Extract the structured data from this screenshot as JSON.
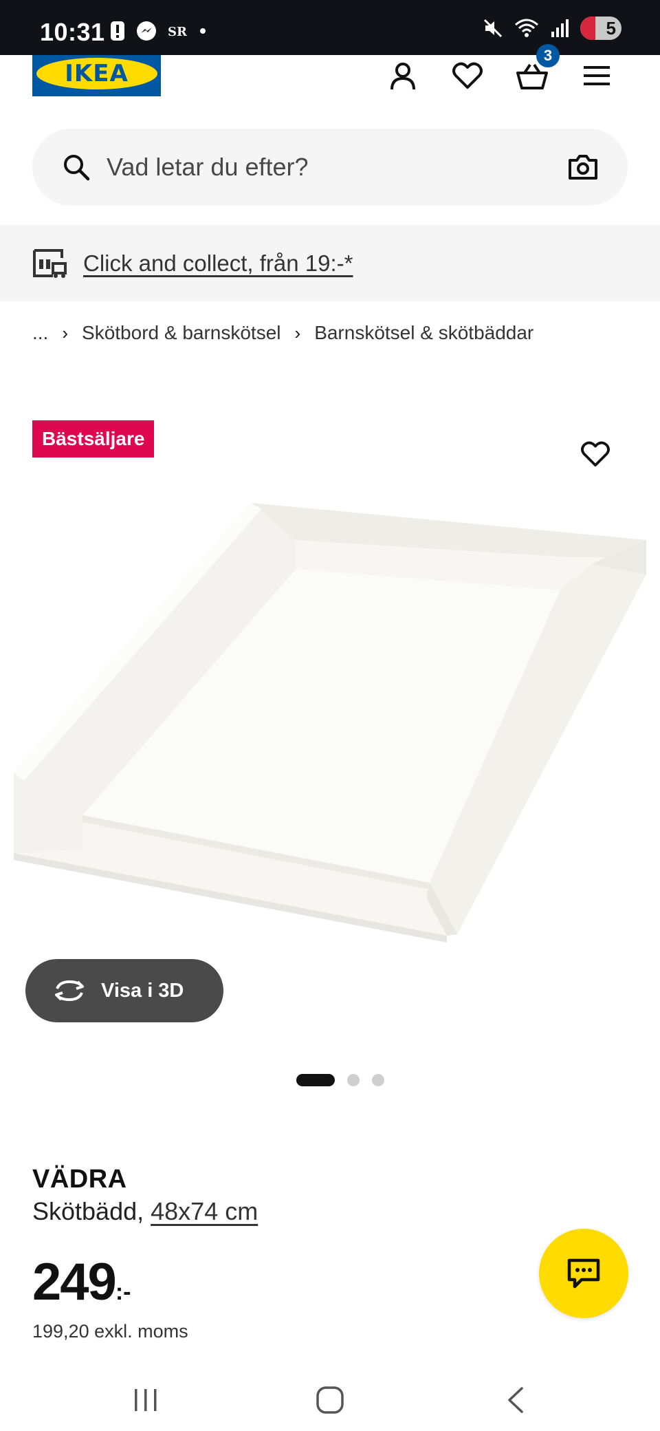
{
  "status_bar": {
    "time": "10:31",
    "battery": "5"
  },
  "header": {
    "logo_text": "IKEA",
    "cart_count": "3"
  },
  "search": {
    "placeholder": "Vad letar du efter?"
  },
  "promo": {
    "text": "Click and collect, från 19:-*"
  },
  "breadcrumb": {
    "ellipsis": "...",
    "items": [
      "Skötbord & barnskötsel",
      "Barnskötsel & skötbäddar"
    ]
  },
  "product": {
    "badge": "Bästsäljare",
    "view_3d_label": "Visa i 3D",
    "image_count": 3,
    "active_image": 1,
    "name": "VÄDRA",
    "type": "Skötbädd,",
    "dimensions": "48x74 cm",
    "price": "249",
    "price_suffix": ":-",
    "price_excl_vat": "199,20 exkl. moms"
  },
  "colors": {
    "ikea_blue": "#0058a3",
    "ikea_yellow": "#ffdb00",
    "badge_red": "#e00751"
  }
}
